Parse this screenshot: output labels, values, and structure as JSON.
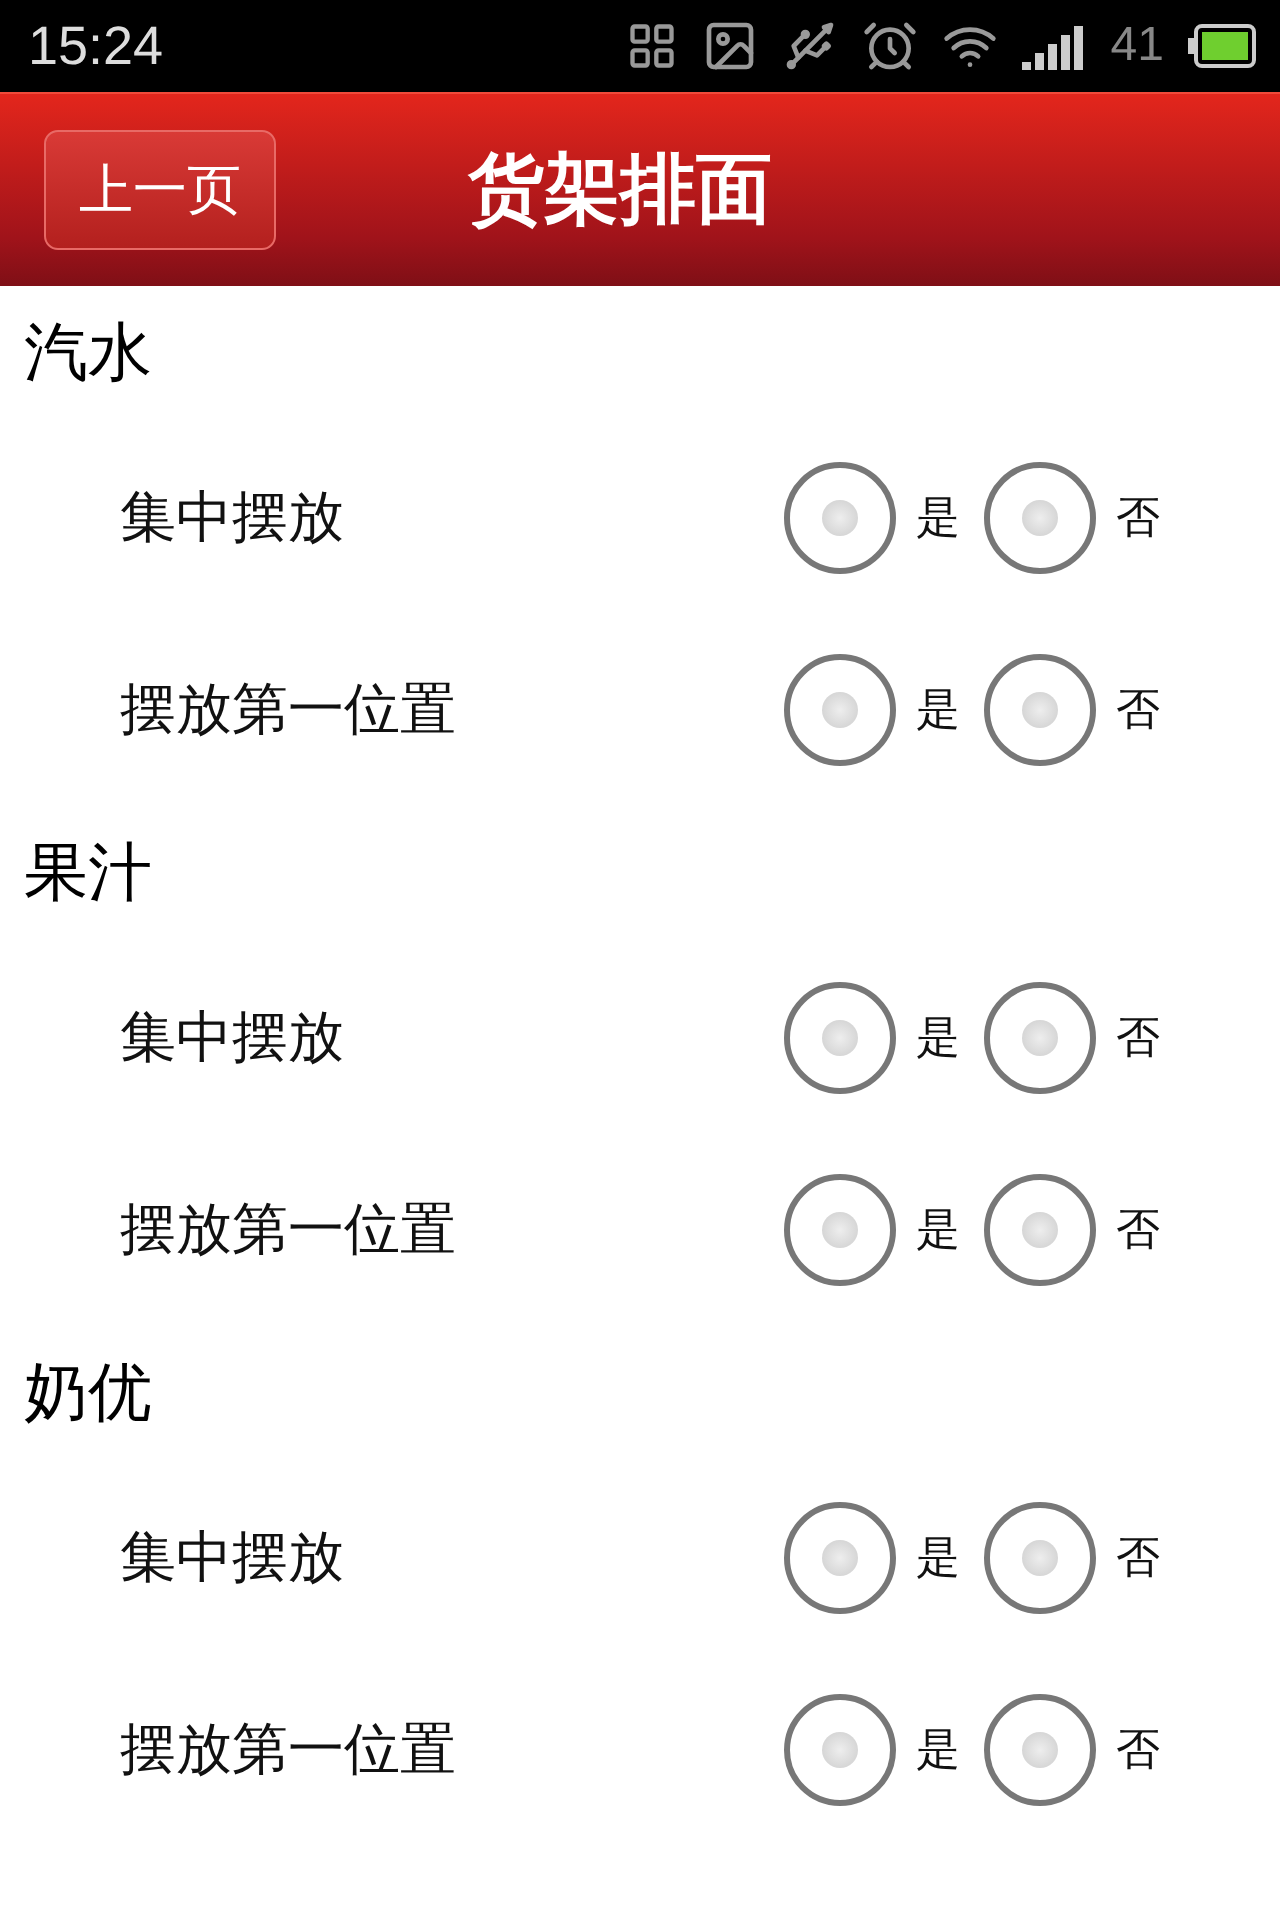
{
  "status_bar": {
    "time": "15:24",
    "battery_level_text": "41"
  },
  "header": {
    "back_button": "上一页",
    "title": "货架排面"
  },
  "sections": [
    {
      "title": "汽水",
      "rows": [
        {
          "label": "集中摆放",
          "options": [
            {
              "label": "是",
              "selected": false
            },
            {
              "label": "否",
              "selected": false
            }
          ]
        },
        {
          "label": "摆放第一位置",
          "options": [
            {
              "label": "是",
              "selected": false
            },
            {
              "label": "否",
              "selected": false
            }
          ]
        }
      ]
    },
    {
      "title": "果汁",
      "rows": [
        {
          "label": "集中摆放",
          "options": [
            {
              "label": "是",
              "selected": false
            },
            {
              "label": "否",
              "selected": false
            }
          ]
        },
        {
          "label": "摆放第一位置",
          "options": [
            {
              "label": "是",
              "selected": false
            },
            {
              "label": "否",
              "selected": false
            }
          ]
        }
      ]
    },
    {
      "title": "奶优",
      "rows": [
        {
          "label": "集中摆放",
          "options": [
            {
              "label": "是",
              "selected": false
            },
            {
              "label": "否",
              "selected": false
            }
          ]
        },
        {
          "label": "摆放第一位置",
          "options": [
            {
              "label": "是",
              "selected": false
            },
            {
              "label": "否",
              "selected": false
            }
          ]
        }
      ]
    }
  ]
}
